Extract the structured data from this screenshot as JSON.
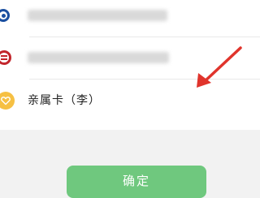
{
  "cards": [
    {
      "label": "",
      "icon": "bank-icon",
      "color": "#1a4fa0",
      "blurred": true
    },
    {
      "label": "",
      "icon": "bank-icon",
      "color": "#c2252b",
      "blurred": true
    },
    {
      "label": "亲属卡（李）",
      "icon": "family-card-icon",
      "color": "#f6c043",
      "blurred": false
    }
  ],
  "confirm": {
    "label": "确定",
    "color": "#6fc87e"
  },
  "annotation": {
    "icon": "arrow-icon",
    "color": "#e0342c"
  }
}
